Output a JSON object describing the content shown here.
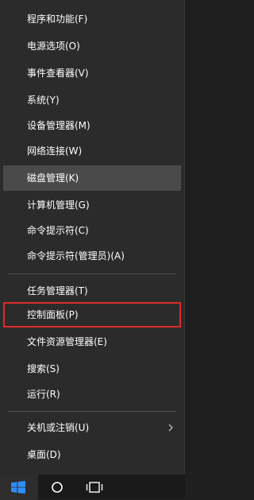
{
  "menu": {
    "items": [
      {
        "label": "程序和功能(F)"
      },
      {
        "label": "电源选项(O)"
      },
      {
        "label": "事件查看器(V)"
      },
      {
        "label": "系统(Y)"
      },
      {
        "label": "设备管理器(M)"
      },
      {
        "label": "网络连接(W)"
      },
      {
        "label": "磁盘管理(K)"
      },
      {
        "label": "计算机管理(G)"
      },
      {
        "label": "命令提示符(C)"
      },
      {
        "label": "命令提示符(管理员)(A)"
      },
      {
        "label": "任务管理器(T)"
      },
      {
        "label": "控制面板(P)"
      },
      {
        "label": "文件资源管理器(E)"
      },
      {
        "label": "搜索(S)"
      },
      {
        "label": "运行(R)"
      },
      {
        "label": "关机或注销(U)"
      },
      {
        "label": "桌面(D)"
      }
    ],
    "hovered_item": "磁盘管理(K)",
    "highlighted_item": "控制面板(P)",
    "submenu_item": "关机或注销(U)"
  },
  "taskbar": {
    "icons": [
      "windows-logo-icon",
      "search-circle-icon",
      "task-view-icon"
    ]
  },
  "colors": {
    "menu_background": "#2b2b2b",
    "hover_background": "#4a4a4a",
    "highlight_border": "#e02b2b",
    "text": "#ffffff"
  }
}
